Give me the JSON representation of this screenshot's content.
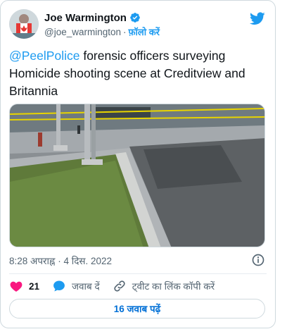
{
  "author": {
    "display_name": "Joe Warmington",
    "handle": "@joe_warmington",
    "separator": "·",
    "follow_label": "फ़ॉलो करें"
  },
  "tweet": {
    "mention": "@PeelPolice",
    "text": " forensic officers surveying Homicide shooting scene at Creditview and Britannia"
  },
  "meta": {
    "time": "8:28 अपराह्न",
    "separator": " · ",
    "date": "4 दिस. 2022"
  },
  "actions": {
    "like_count": "21",
    "reply_label": "जवाब दें",
    "copy_link_label": "ट्वीट का लिंक कॉपी करें"
  },
  "replies_button": "16 जवाब पढ़ें",
  "colors": {
    "brand_blue": "#1d9bf0",
    "like_red": "#f91880",
    "text_secondary": "#536471"
  },
  "icons": [
    "verified-badge-icon",
    "twitter-bird-icon",
    "info-icon",
    "heart-icon",
    "reply-bubble-icon",
    "link-icon"
  ]
}
